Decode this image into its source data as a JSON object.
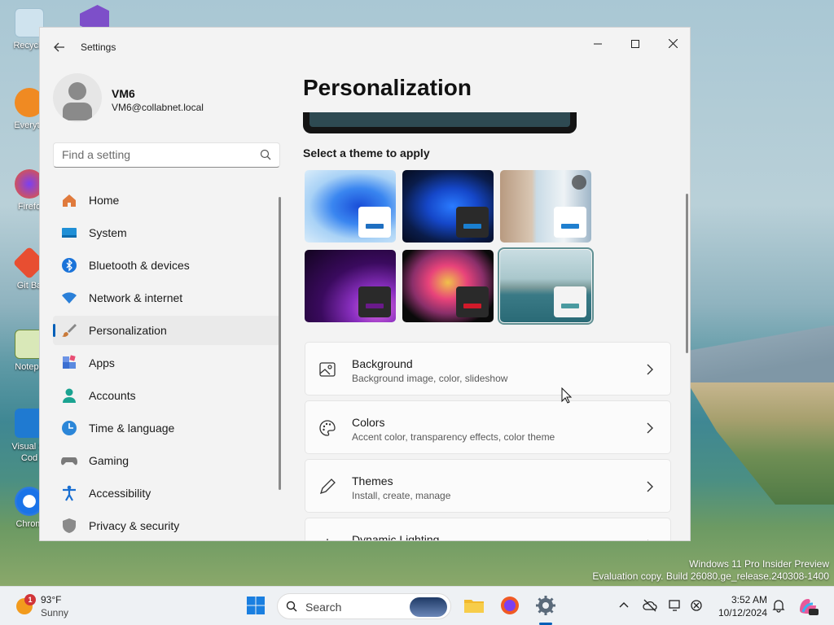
{
  "desktop": {
    "icons": [
      "Recycle",
      "Everyth",
      "Firefo",
      "Git Ba",
      "Notepa",
      "Visual St\nCod",
      "Chrom"
    ],
    "watermark_line1": "Windows 11 Pro Insider Preview",
    "watermark_line2": "Evaluation copy. Build 26080.ge_release.240308-1400"
  },
  "window": {
    "title": "Settings",
    "minimize_icon": "minimize-icon",
    "maximize_icon": "maximize-icon",
    "close_icon": "close-icon"
  },
  "user": {
    "name": "VM6",
    "email": "VM6@collabnet.local"
  },
  "search": {
    "placeholder": "Find a setting"
  },
  "sidebar": {
    "items": [
      {
        "label": "Home",
        "icon": "home-icon",
        "color": "#e07a3c"
      },
      {
        "label": "System",
        "icon": "system-icon",
        "color": "#1f8fd6"
      },
      {
        "label": "Bluetooth & devices",
        "icon": "bluetooth-icon",
        "color": "#1a73d9"
      },
      {
        "label": "Network & internet",
        "icon": "wifi-icon",
        "color": "#2a7fd8"
      },
      {
        "label": "Personalization",
        "icon": "brush-icon",
        "color": "#c97a3a",
        "active": true
      },
      {
        "label": "Apps",
        "icon": "apps-icon",
        "color": "#3b6fd1"
      },
      {
        "label": "Accounts",
        "icon": "accounts-icon",
        "color": "#1aa391"
      },
      {
        "label": "Time & language",
        "icon": "globe-clock-icon",
        "color": "#2b86d8"
      },
      {
        "label": "Gaming",
        "icon": "gamepad-icon",
        "color": "#7a7a7a"
      },
      {
        "label": "Accessibility",
        "icon": "accessibility-icon",
        "color": "#1a6fd1"
      },
      {
        "label": "Privacy & security",
        "icon": "shield-icon",
        "color": "#8a8a8a"
      }
    ]
  },
  "main": {
    "title": "Personalization",
    "themes_label": "Select a theme to apply",
    "themes": [
      {
        "name": "windows-light",
        "bar_color": "#1f6fc1"
      },
      {
        "name": "windows-dark",
        "bar_color": "#1a7fd0"
      },
      {
        "name": "flowers",
        "bar_color": "#1f7fcf"
      },
      {
        "name": "glow",
        "bar_color": "#6a1a8a"
      },
      {
        "name": "captured-motion",
        "bar_color": "#d01a2a"
      },
      {
        "name": "sunrise-lake",
        "bar_color": "#4a9aa0",
        "selected": true
      }
    ],
    "cards": [
      {
        "title": "Background",
        "subtitle": "Background image, color, slideshow",
        "icon": "image-icon"
      },
      {
        "title": "Colors",
        "subtitle": "Accent color, transparency effects, color theme",
        "icon": "palette-icon"
      },
      {
        "title": "Themes",
        "subtitle": "Install, create, manage",
        "icon": "pen-icon"
      },
      {
        "title": "Dynamic Lighting",
        "subtitle": "",
        "icon": "lighting-icon"
      }
    ]
  },
  "taskbar": {
    "weather_alert": "1",
    "weather_temp": "93°F",
    "weather_condition": "Sunny",
    "search_label": "Search",
    "time": "3:52 AM",
    "date": "10/12/2024"
  }
}
